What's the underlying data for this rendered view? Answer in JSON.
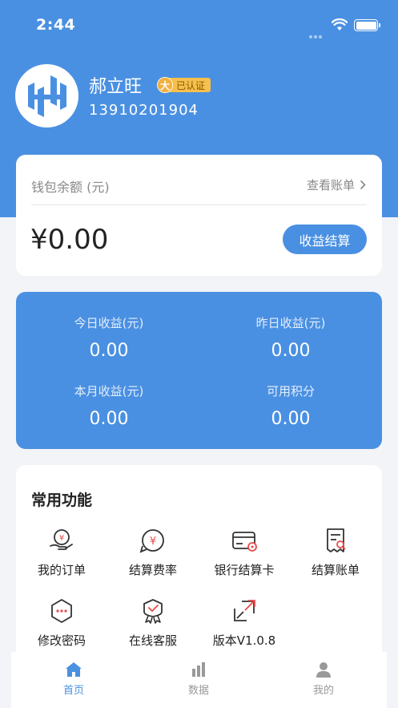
{
  "status_bar": {
    "time": "2:44"
  },
  "user": {
    "name": "郝立旺",
    "badge": "已认证",
    "badge_medal": "大",
    "phone": "13910201904"
  },
  "wallet": {
    "label": "钱包余额 (元)",
    "bill_link": "查看账单",
    "amount": "¥0.00",
    "settle_button": "收益结算"
  },
  "stats": [
    {
      "label": "今日收益(元)",
      "value": "0.00"
    },
    {
      "label": "昨日收益(元)",
      "value": "0.00"
    },
    {
      "label": "本月收益(元)",
      "value": "0.00"
    },
    {
      "label": "可用积分",
      "value": "0.00"
    }
  ],
  "functions": {
    "title": "常用功能",
    "items": [
      {
        "label": "我的订单",
        "icon": "order-icon"
      },
      {
        "label": "结算费率",
        "icon": "rate-icon"
      },
      {
        "label": "银行结算卡",
        "icon": "bank-card-icon"
      },
      {
        "label": "结算账单",
        "icon": "bill-icon"
      },
      {
        "label": "修改密码",
        "icon": "password-icon"
      },
      {
        "label": "在线客服",
        "icon": "service-icon"
      },
      {
        "label": "版本V1.0.8",
        "icon": "version-icon"
      }
    ]
  },
  "tabbar": [
    {
      "label": "首页",
      "icon": "home-icon",
      "active": true
    },
    {
      "label": "数据",
      "icon": "chart-icon",
      "active": false
    },
    {
      "label": "我的",
      "icon": "profile-icon",
      "active": false
    }
  ],
  "colors": {
    "primary": "#4a90e2",
    "accent_red": "#e84a4a",
    "badge_gold": "#f5c04c"
  }
}
